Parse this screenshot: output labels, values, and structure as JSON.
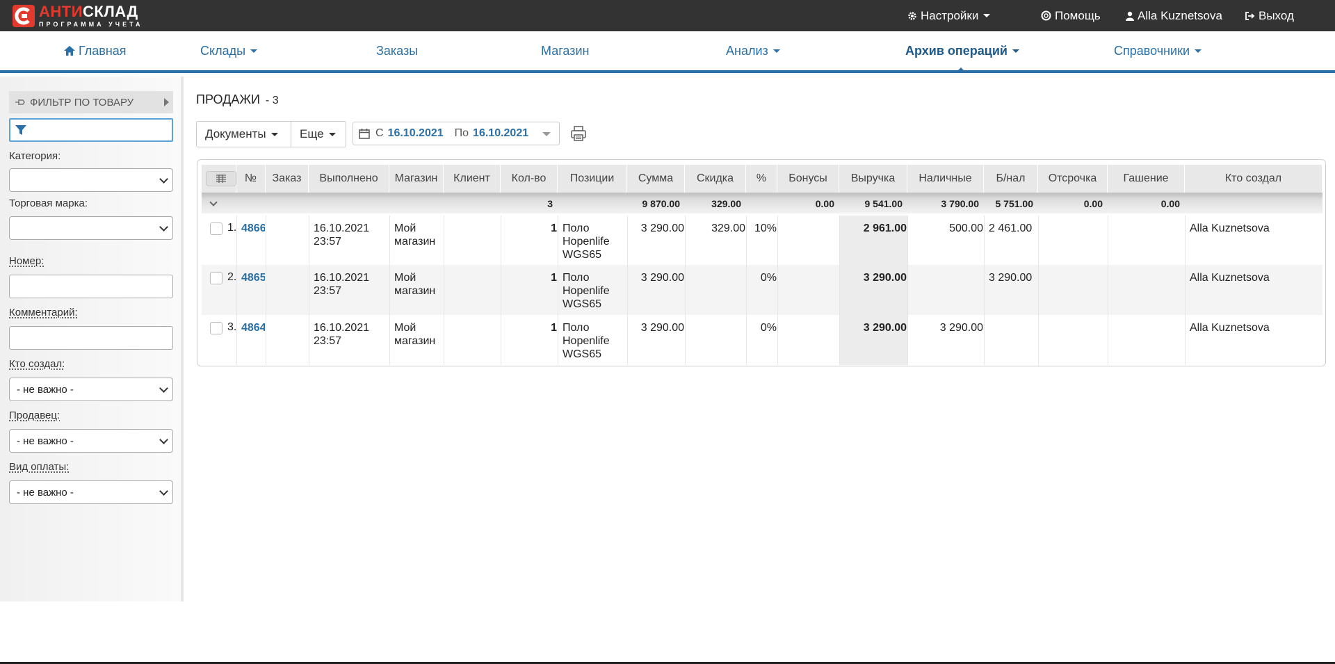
{
  "app": {
    "logo_main_a": "АНТИ",
    "logo_main_b": "СКЛАД",
    "logo_sub": "ПРОГРАММА УЧЕТА"
  },
  "topbar": {
    "settings": "Настройки",
    "help": "Помощь",
    "user": "Alla Kuznetsova",
    "logout": "Выход"
  },
  "nav": {
    "home": "Главная",
    "warehouses": "Склады",
    "orders": "Заказы",
    "shop": "Магазин",
    "analysis": "Анализ",
    "archive": "Архив операций",
    "references": "Справочники"
  },
  "sidebar": {
    "filter_title": "ФИЛЬТР ПО ТОВАРУ",
    "product_filter_value": "",
    "category_label": "Категория:",
    "category_value": "",
    "brand_label": "Торговая марка:",
    "brand_value": "",
    "number_label": "Номер:",
    "number_value": "",
    "comment_label": "Комментарий:",
    "comment_value": "",
    "creator_label": "Кто создал:",
    "creator_value": "- не важно -",
    "seller_label": "Продавец:",
    "seller_value": "- не важно -",
    "payment_label": "Вид оплаты:",
    "payment_value": "- не важно -"
  },
  "main": {
    "title": "ПРОДАЖИ",
    "count": "- 3",
    "docs_button": "Документы",
    "more_button": "Еще",
    "date_from_label": "С",
    "date_from": "16.10.2021",
    "date_to_label": "По",
    "date_to": "16.10.2021"
  },
  "table": {
    "headers": [
      "№",
      "Заказ",
      "Выполнено",
      "Магазин",
      "Клиент",
      "Кол-во",
      "Позиции",
      "Сумма",
      "Скидка",
      "%",
      "Бонусы",
      "Выручка",
      "Наличные",
      "Б/нал",
      "Отсрочка",
      "Гашение",
      "Кто создал"
    ],
    "totals": {
      "qty": "3",
      "sum": "9 870.00",
      "discount": "329.00",
      "bonus": "0.00",
      "revenue": "9 541.00",
      "cash": "3 790.00",
      "noncash": "5 751.00",
      "deferral": "0.00",
      "repay": "0.00"
    },
    "rows": [
      {
        "idx": "1.",
        "num": "4866",
        "order": "",
        "done": "16.10.2021 23:57",
        "shop": "Мой магазин",
        "client": "",
        "qty": "1",
        "pos": "Поло Hopenlife WGS65",
        "sum": "3 290.00",
        "discount": "329.00",
        "pct": "10%",
        "bonus": "",
        "revenue": "2 961.00",
        "cash": "500.00",
        "noncash": "2 461.00",
        "deferral": "",
        "repay": "",
        "creator": "Alla Kuznetsova"
      },
      {
        "idx": "2.",
        "num": "4865",
        "order": "",
        "done": "16.10.2021 23:57",
        "shop": "Мой магазин",
        "client": "",
        "qty": "1",
        "pos": "Поло Hopenlife WGS65",
        "sum": "3 290.00",
        "discount": "",
        "pct": "0%",
        "bonus": "",
        "revenue": "3 290.00",
        "cash": "",
        "noncash": "3 290.00",
        "deferral": "",
        "repay": "",
        "creator": "Alla Kuznetsova"
      },
      {
        "idx": "3.",
        "num": "4864",
        "order": "",
        "done": "16.10.2021 23:57",
        "shop": "Мой магазин",
        "client": "",
        "qty": "1",
        "pos": "Поло Hopenlife WGS65",
        "sum": "3 290.00",
        "discount": "",
        "pct": "0%",
        "bonus": "",
        "revenue": "3 290.00",
        "cash": "3 290.00",
        "noncash": "",
        "deferral": "",
        "repay": "",
        "creator": "Alla Kuznetsova"
      }
    ]
  },
  "colors": {
    "topbar_bg": "#333333",
    "accent": "#2a6fa5",
    "logo_red": "#e23b2e"
  }
}
